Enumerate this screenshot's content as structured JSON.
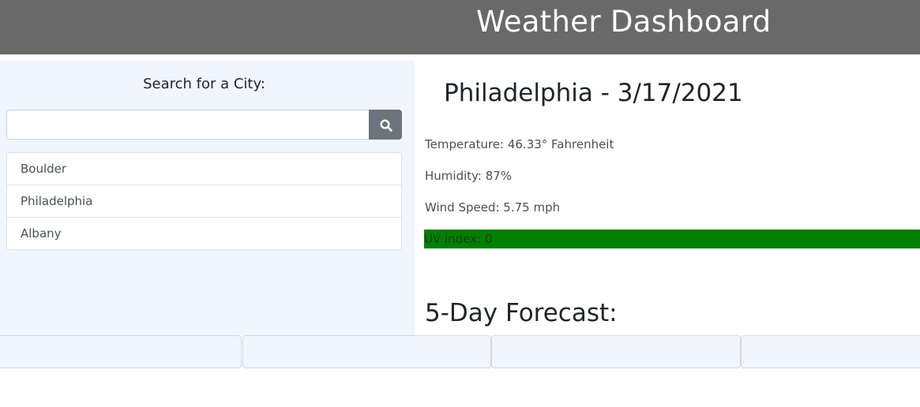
{
  "header": {
    "title": "Weather Dashboard"
  },
  "sidebar": {
    "search_label": "Search for a City:",
    "search_input": {
      "value": "",
      "placeholder": ""
    },
    "search_button_icon": "search-icon",
    "cities": [
      {
        "label": "Boulder"
      },
      {
        "label": "Philadelphia"
      },
      {
        "label": "Albany"
      }
    ]
  },
  "current": {
    "title": "Philadelphia - 3/17/2021",
    "temperature": "Temperature: 46.33° Fahrenheit",
    "humidity": "Humidity: 87%",
    "wind_speed": "Wind Speed: 5.75 mph",
    "uv_index": "UV index: 0",
    "uv_color": "#008000"
  },
  "forecast": {
    "title": "5-Day Forecast:",
    "cards": [
      {},
      {},
      {},
      {}
    ]
  },
  "colors": {
    "header_bg": "#696969",
    "sidebar_bg": "#eff6fd",
    "button_bg": "#6c757d"
  }
}
